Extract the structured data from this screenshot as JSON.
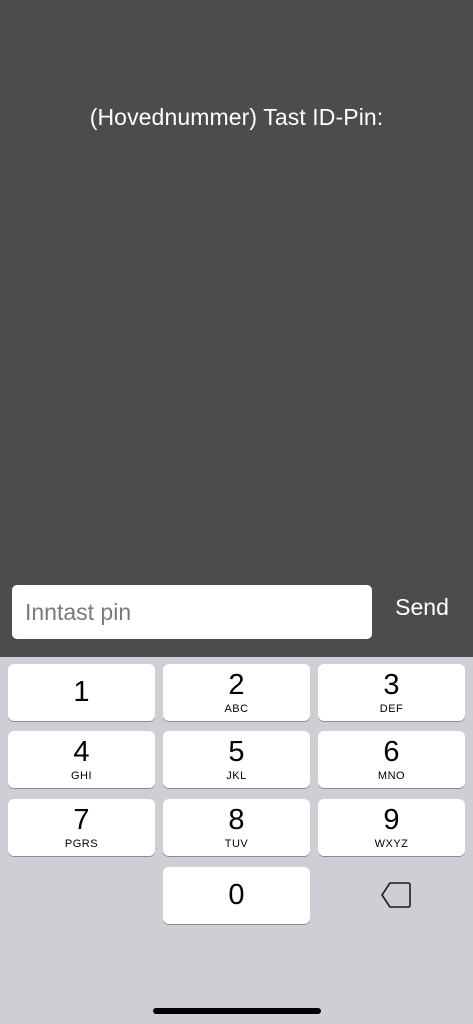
{
  "prompt": {
    "text": "(Hovednummer) Tast ID-Pin:"
  },
  "pin_input": {
    "value": "",
    "placeholder": "Inntast pin"
  },
  "send_label": "Send",
  "keypad": {
    "keys": [
      {
        "digit": "1",
        "letters": ""
      },
      {
        "digit": "2",
        "letters": "ABC"
      },
      {
        "digit": "3",
        "letters": "DEF"
      },
      {
        "digit": "4",
        "letters": "GHI"
      },
      {
        "digit": "5",
        "letters": "JKL"
      },
      {
        "digit": "6",
        "letters": "MNO"
      },
      {
        "digit": "7",
        "letters": "PGRS"
      },
      {
        "digit": "8",
        "letters": "TUV"
      },
      {
        "digit": "9",
        "letters": "WXYZ"
      },
      {
        "digit": "0",
        "letters": ""
      }
    ],
    "backspace_icon": "backspace-icon"
  },
  "colors": {
    "background": "#4c4c4c",
    "keyboard_background": "#cdcfd4",
    "key_background": "#ffffff",
    "text_light": "#ffffff"
  }
}
